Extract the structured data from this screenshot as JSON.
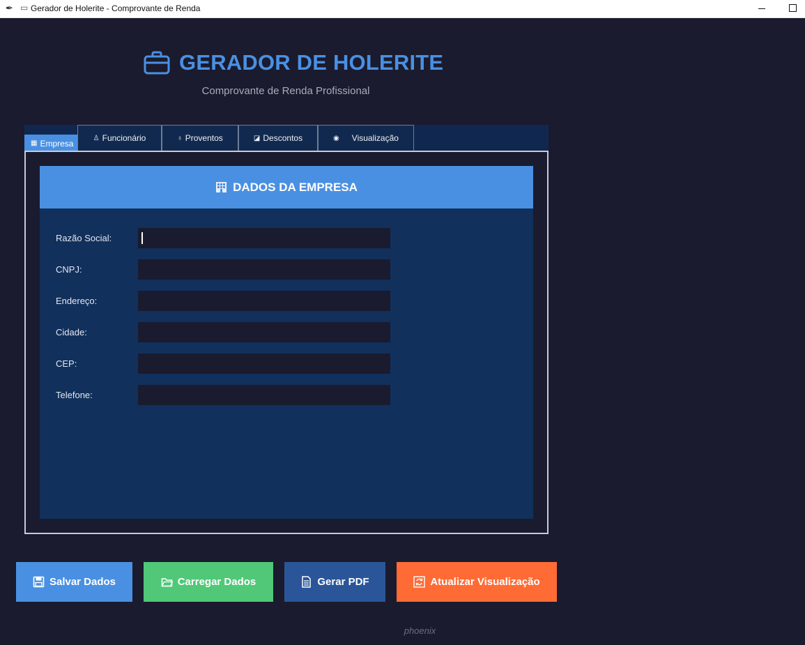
{
  "window": {
    "title": "Gerador de Holerite - Comprovante de Renda"
  },
  "header": {
    "title": "GERADOR DE HOLERITE",
    "subtitle": "Comprovante de Renda Profissional"
  },
  "tabs": [
    {
      "label": "Empresa",
      "icon": "building-icon",
      "active": true
    },
    {
      "label": "Funcionário",
      "icon": "person-icon",
      "active": false
    },
    {
      "label": "Proventos",
      "icon": "money-bag-icon",
      "active": false
    },
    {
      "label": "Descontos",
      "icon": "discount-icon",
      "active": false
    },
    {
      "label": "Visualização",
      "icon": "eye-icon",
      "active": false
    }
  ],
  "section": {
    "title": "DADOS DA EMPRESA",
    "icon": "building-icon"
  },
  "fields": [
    {
      "label": "Razão Social:",
      "value": ""
    },
    {
      "label": "CNPJ:",
      "value": ""
    },
    {
      "label": "Endereço:",
      "value": ""
    },
    {
      "label": "Cidade:",
      "value": ""
    },
    {
      "label": "CEP:",
      "value": ""
    },
    {
      "label": "Telefone:",
      "value": ""
    }
  ],
  "actions": [
    {
      "label": "Salvar Dados",
      "icon": "floppy-icon",
      "color": "#4a90e2"
    },
    {
      "label": "Carregar Dados",
      "icon": "folder-icon",
      "color": "#50c878"
    },
    {
      "label": "Gerar PDF",
      "icon": "document-icon",
      "color": "#2a5699"
    },
    {
      "label": "Atualizar Visualização",
      "icon": "refresh-icon",
      "color": "#ff6b35"
    }
  ],
  "footer": {
    "text": "phoenix"
  }
}
